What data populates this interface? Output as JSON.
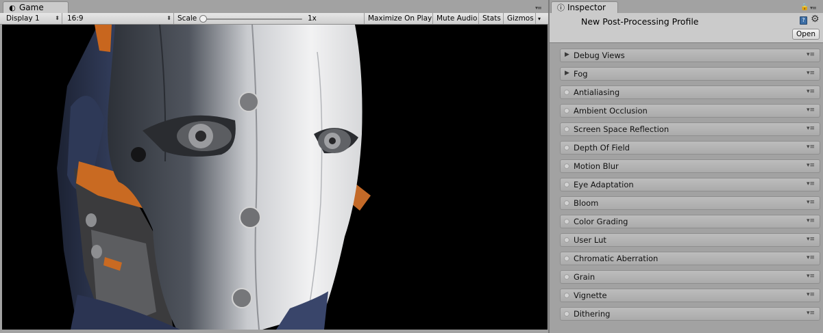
{
  "game": {
    "tab_icon": "pacman-icon",
    "tab_title": "Game",
    "display": "Display 1",
    "aspect": "16:9",
    "scale_label": "Scale",
    "scale_value": "1x",
    "scale_level": 0,
    "maximize_on_play": "Maximize On Play",
    "mute_audio": "Mute Audio",
    "stats": "Stats",
    "gizmos": "Gizmos"
  },
  "inspector": {
    "tab_icon": "info-icon",
    "tab_title": "Inspector",
    "profile_name": "New Post-Processing Profile",
    "open_label": "Open",
    "effects": [
      {
        "label": "Debug Views",
        "kind": "foldout"
      },
      {
        "label": "Fog",
        "kind": "foldout"
      },
      {
        "label": "Antialiasing",
        "kind": "toggle"
      },
      {
        "label": "Ambient Occlusion",
        "kind": "toggle"
      },
      {
        "label": "Screen Space Reflection",
        "kind": "toggle"
      },
      {
        "label": "Depth Of Field",
        "kind": "toggle"
      },
      {
        "label": "Motion Blur",
        "kind": "toggle"
      },
      {
        "label": "Eye Adaptation",
        "kind": "toggle"
      },
      {
        "label": "Bloom",
        "kind": "toggle"
      },
      {
        "label": "Color Grading",
        "kind": "toggle"
      },
      {
        "label": "User Lut",
        "kind": "toggle"
      },
      {
        "label": "Chromatic Aberration",
        "kind": "toggle"
      },
      {
        "label": "Grain",
        "kind": "toggle"
      },
      {
        "label": "Vignette",
        "kind": "toggle"
      },
      {
        "label": "Dithering",
        "kind": "toggle"
      }
    ]
  }
}
